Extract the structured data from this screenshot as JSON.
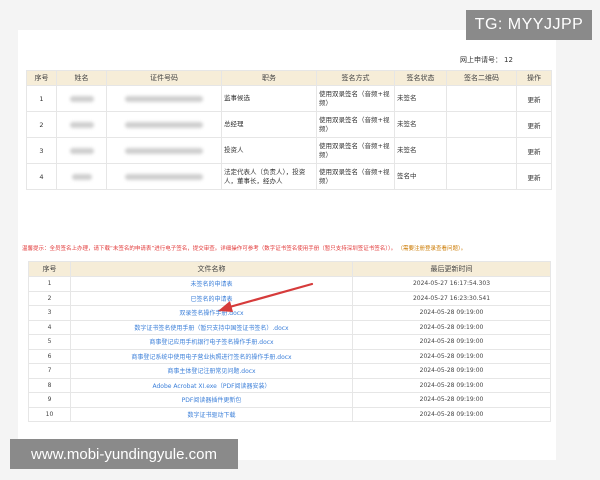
{
  "watermark_tag": "TG: MYYJJPP",
  "watermark_site": "www.mobi-yundingyule.com",
  "application": {
    "label": "网上申请号：",
    "value": "12"
  },
  "signers_table": {
    "headers": [
      "序号",
      "姓名",
      "证件号码",
      "职务",
      "签名方式",
      "签名状态",
      "签名二维码",
      "操作"
    ],
    "rows": [
      {
        "index": "1",
        "role": "监事候选",
        "method": "使用双录签名（音频+视频）",
        "status": "未签名",
        "action": "更新"
      },
      {
        "index": "2",
        "role": "总经理",
        "method": "使用双录签名（音频+视频）",
        "status": "未签名",
        "action": "更新"
      },
      {
        "index": "3",
        "role": "投资人",
        "method": "使用双录签名（音频+视频）",
        "status": "未签名",
        "action": "更新"
      },
      {
        "index": "4",
        "role": "法定代表人（负责人），投资人，董事长，经办人",
        "method": "使用双录签名（音频+视频）",
        "status": "签名中",
        "action": "更新"
      }
    ]
  },
  "notice": {
    "text": "温馨提示：全员签名上办理，请下载“未签名的申请表”进行电子签名，提交审查。详细操作可参考（数字证书签名使用手册（暂只支持深圳签证书签名））。",
    "tail": "（需要注册登录查看问题）。"
  },
  "docs_table": {
    "headers": [
      "序号",
      "文件名称",
      "最后更新时间"
    ],
    "rows": [
      {
        "index": "1",
        "name": "未签名的申请表",
        "time": "2024-05-27 16:17:54.303"
      },
      {
        "index": "2",
        "name": "已签名的申请表",
        "time": "2024-05-27 16:23:30.541"
      },
      {
        "index": "3",
        "name": "双录签名操作手册.docx",
        "time": "2024-05-28 09:19:00"
      },
      {
        "index": "4",
        "name": "数字证书签名使用手册（暂只支持中国签证书签名）.docx",
        "time": "2024-05-28 09:19:00"
      },
      {
        "index": "5",
        "name": "商事登记应用手机银行电子签名操作手册.docx",
        "time": "2024-05-28 09:19:00"
      },
      {
        "index": "6",
        "name": "商事登记系统中使用电子营业执照进行签名的操作手册.docx",
        "time": "2024-05-28 09:19:00"
      },
      {
        "index": "7",
        "name": "商事主体登记注册常见问题.docx",
        "time": "2024-05-28 09:19:00"
      },
      {
        "index": "8",
        "name": "Adobe Acrobat XI.exe（PDF阅读器安装）",
        "time": "2024-05-28 09:19:00"
      },
      {
        "index": "9",
        "name": "PDF阅读器插件更新包",
        "time": "2024-05-28 09:19:00"
      },
      {
        "index": "10",
        "name": "数字证书驱动下载",
        "time": "2024-05-28 09:19:00"
      }
    ]
  },
  "colors": {
    "header_bg": "#f6edd8",
    "link": "#3b7fd9",
    "notice": "#e23b3b",
    "arrow": "#d63b3b"
  },
  "icons": [
    "red-arrow-icon"
  ]
}
